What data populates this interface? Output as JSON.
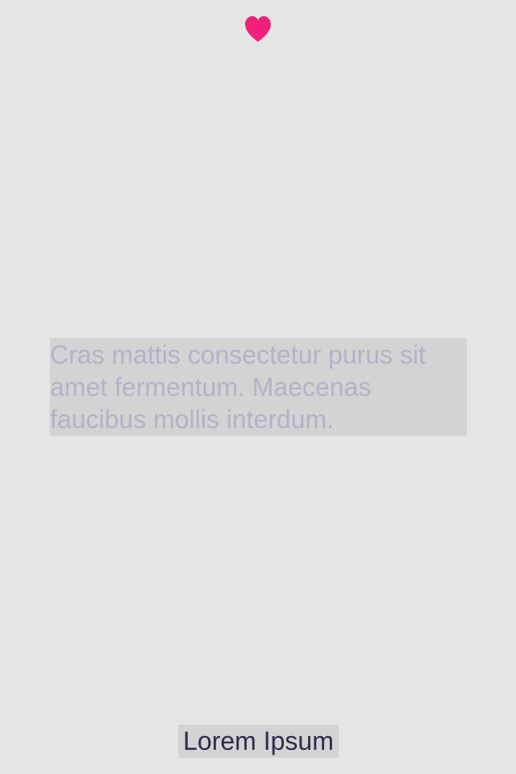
{
  "icons": {
    "heart": {
      "name": "heart-icon",
      "color": "#f0217a"
    }
  },
  "content": {
    "body_text": "Cras mattis consectetur purus sit amet fermentum. Maecenas faucibus mollis interdum.",
    "body_text_color": "#b3b3c7"
  },
  "footer": {
    "label": "Lorem Ipsum",
    "label_color": "#2e2d4d"
  },
  "colors": {
    "background": "#e5e5e5",
    "text_highlight": "#d3d3d3"
  }
}
